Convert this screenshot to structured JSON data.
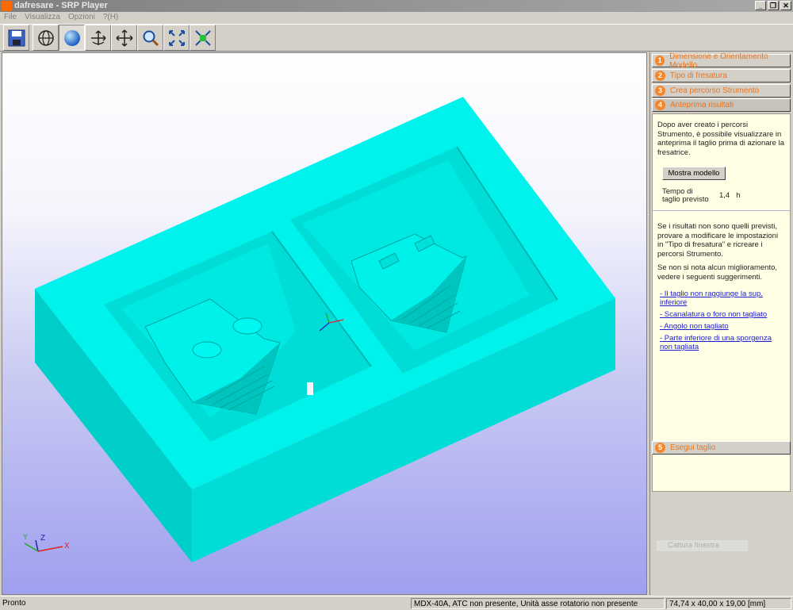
{
  "window": {
    "title": "dafresare - SRP Player",
    "controls": [
      "minimize",
      "restore",
      "close"
    ]
  },
  "menu": [
    "File",
    "Visualizza",
    "Opzioni",
    "?(H)"
  ],
  "toolbar": {
    "buttons": [
      {
        "icon": "save-icon"
      },
      {
        "icon": "wireframe-globe-icon"
      },
      {
        "icon": "shaded-sphere-icon"
      },
      {
        "icon": "rotate-axes-icon"
      },
      {
        "icon": "move-arrows-icon"
      },
      {
        "icon": "zoom-icon"
      },
      {
        "icon": "fit-to-view-icon"
      },
      {
        "icon": "center-view-icon"
      }
    ]
  },
  "viewport": {
    "model_color": "#00e6e0",
    "axes": {
      "x": "X",
      "y": "Y",
      "z": "Z"
    }
  },
  "steps": [
    {
      "num": "1",
      "label": "Dimensione e Orientamento Modello"
    },
    {
      "num": "2",
      "label": "Tipo di fresatura"
    },
    {
      "num": "3",
      "label": "Crea percorso Strumento"
    },
    {
      "num": "4",
      "label": "Anteprima risultati"
    }
  ],
  "preview": {
    "intro": "Dopo aver creato i percorsi Strumento, è possibile visualizzare in anteprima il taglio prima di azionare la fresatrice.",
    "show_model_button": "Mostra modello",
    "time_label": "Tempo di taglio previsto",
    "time_value": "1,4",
    "time_unit": "h",
    "tip1": "Se i risultati non sono quelli previsti, provare a modificare le impostazioni in \"Tipo di fresatura\" e ricreare i percorsi Strumento.",
    "tip2": "Se non si nota alcun miglioramento, vedere i seguenti suggerimenti.",
    "links": [
      "- Il taglio non raggiunge la sup. inferiore",
      "- Scanalatura o foro non tagliato",
      "- Angolo non tagliato",
      "- Parte inferiore di una sporgenza non tagliata"
    ]
  },
  "step5": {
    "num": "5",
    "label": "Esegui taglio"
  },
  "disabled_button": "Cattura finestra",
  "status": {
    "left": "Pronto",
    "machine": "MDX-40A, ATC non presente, Unità asse rotatorio non presente",
    "dimensions": "74,74 x 40,00 x 19,00 [mm]"
  }
}
